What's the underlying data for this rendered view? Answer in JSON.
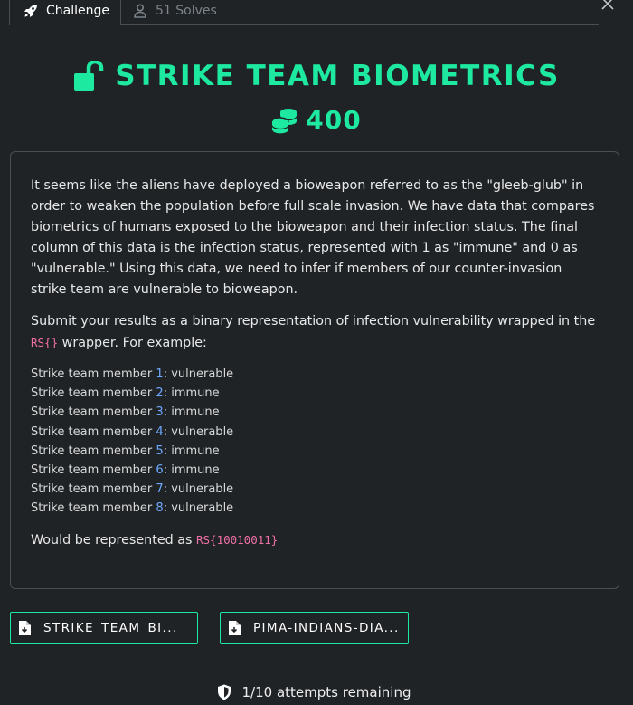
{
  "tabs": [
    {
      "label": "Challenge",
      "icon": "rocket-icon",
      "active": true
    },
    {
      "label": "51 Solves",
      "icon": "user-icon",
      "active": false
    }
  ],
  "challenge": {
    "title": "STRIKE TEAM BIOMETRICS",
    "points": "400",
    "accent_color": "#1de9a0"
  },
  "description": {
    "paragraph1": "It seems like the aliens have deployed a bioweapon referred to as the \"gleeb-glub\" in order to weaken the population before full scale invasion. We have data that compares biometrics of humans exposed to the bioweapon and their infection status. The final column of this data is the infection status, represented with 1 as \"immune\" and 0 as \"vulnerable.\" Using this data, we need to infer if members of our counter-invasion strike team are vulnerable to bioweapon.",
    "paragraph2_before": "Submit your results as a binary representation of infection vulnerability wrapped in the ",
    "paragraph2_code": "RS{}",
    "paragraph2_after": " wrapper. For example:",
    "member_prefix": "Strike team member ",
    "members": [
      {
        "num": "1",
        "status": "vulnerable"
      },
      {
        "num": "2",
        "status": "immune"
      },
      {
        "num": "3",
        "status": "immune"
      },
      {
        "num": "4",
        "status": "vulnerable"
      },
      {
        "num": "5",
        "status": "immune"
      },
      {
        "num": "6",
        "status": "immune"
      },
      {
        "num": "7",
        "status": "vulnerable"
      },
      {
        "num": "8",
        "status": "vulnerable"
      }
    ],
    "result_text": "Would be represented as ",
    "result_code": "RS{10010011}"
  },
  "files": [
    {
      "label": "STRIKE_TEAM_BI...",
      "icon": "file-download-icon"
    },
    {
      "label": "PIMA-INDIANS-DIA...",
      "icon": "file-download-icon"
    }
  ],
  "attempts": {
    "text": "1/10 attempts remaining",
    "icon": "shield-icon"
  }
}
